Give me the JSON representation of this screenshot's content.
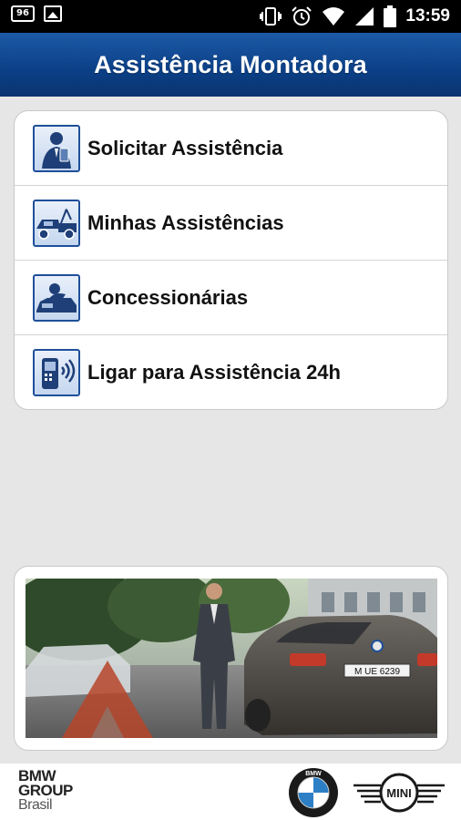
{
  "status_bar": {
    "notification_icons": [
      "sim-card-icon",
      "image-icon"
    ],
    "sim_label": "96",
    "system_icons": [
      "vibrate-icon",
      "alarm-icon",
      "wifi-icon",
      "signal-icon",
      "battery-icon"
    ],
    "time": "13:59"
  },
  "header": {
    "title": "Assistência Montadora"
  },
  "menu": {
    "items": [
      {
        "label": "Solicitar Assistência",
        "icon": "man-with-phone-icon"
      },
      {
        "label": "Minhas Assistências",
        "icon": "tow-truck-icon"
      },
      {
        "label": "Concessionárias",
        "icon": "car-service-icon"
      },
      {
        "label": "Ligar para Assistência 24h",
        "icon": "phone-call-icon"
      }
    ]
  },
  "banner": {
    "image": "bmw-roadside-assistance-photo",
    "plate_text": "M UE 6239"
  },
  "footer": {
    "group_line1": "BMW",
    "group_line2": "GROUP",
    "group_line3": "Brasil",
    "bmw_logo_text": "BMW",
    "mini_logo_text": "MINI"
  },
  "colors": {
    "header_blue": "#0b3f85",
    "icon_border": "#1f4f9a",
    "background": "#e6e6e6"
  }
}
